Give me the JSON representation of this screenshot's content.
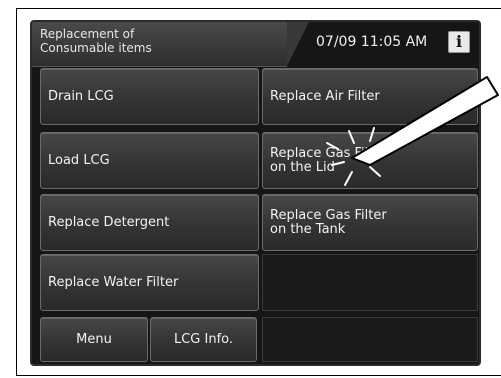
{
  "header": {
    "title_line1": "Replacement of",
    "title_line2": "Consumable items",
    "datetime": "07/09 11:05 AM",
    "info_label": "i"
  },
  "buttons": {
    "drain_lcg": "Drain LCG",
    "load_lcg": "Load LCG",
    "replace_detergent": "Replace Detergent",
    "replace_water_filter": "Replace Water Filter",
    "replace_air_filter": "Replace Air Filter",
    "replace_gas_filter_lid_line1": "Replace Gas Filter",
    "replace_gas_filter_lid_line2": "on the Lid",
    "replace_gas_filter_tank_line1": "Replace Gas Filter",
    "replace_gas_filter_tank_line2": "on the Tank"
  },
  "footer": {
    "menu_label": "Menu",
    "lcg_info_label": "LCG Info."
  },
  "icons": {
    "info": "info-icon",
    "pointer": "stylus-pointer"
  },
  "colors": {
    "screen_bg": "#161616",
    "button_text": "#f2f2f2"
  }
}
